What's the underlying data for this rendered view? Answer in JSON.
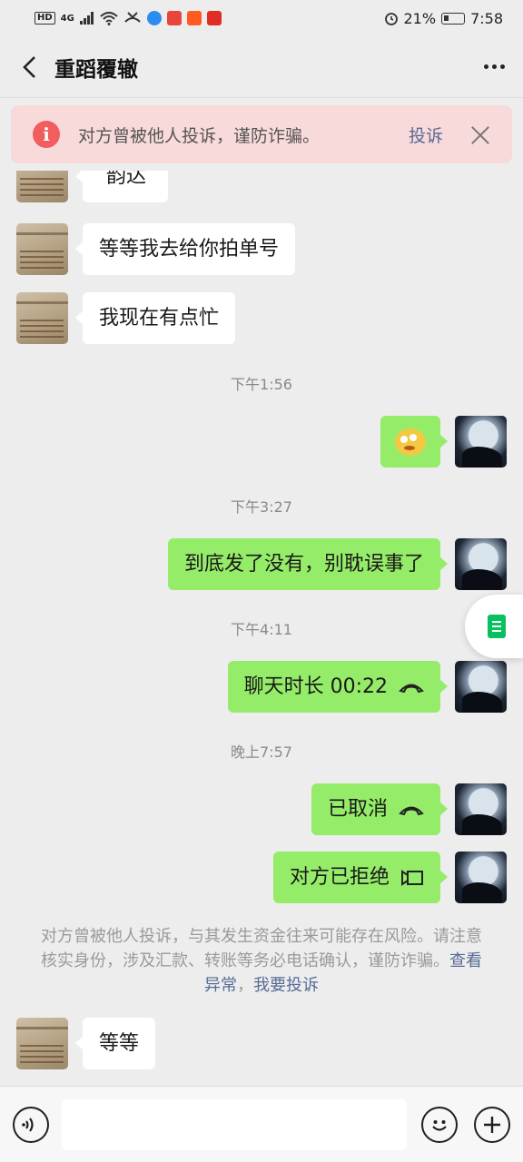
{
  "status_bar": {
    "network": "4G",
    "battery": "21%",
    "time": "7:58"
  },
  "header": {
    "title": "重蹈覆辙"
  },
  "warning": {
    "text": "对方曾被他人投诉，谨防诈骗。",
    "complain_label": "投诉"
  },
  "messages": {
    "m1": "韵达",
    "m2": "等等我去给你拍单号",
    "m3": "我现在有点忙",
    "t1": "下午1:56",
    "t2": "下午3:27",
    "m5": "到底发了没有，别耽误事了",
    "t3": "下午4:11",
    "m6": "聊天时长 00:22",
    "t4": "晚上7:57",
    "m7": "已取消",
    "m8": "对方已拒绝",
    "m9": "等等"
  },
  "notice": {
    "text": "对方曾被他人投诉，与其发生资金往来可能存在风险。请注意核实身份，涉及汇款、转账等务必电话确认，谨防诈骗。",
    "link_view": "查看异常",
    "separator": "，",
    "link_report": "我要投诉"
  },
  "colors": {
    "outgoing_bubble": "#95ec69",
    "incoming_bubble": "#ffffff",
    "link": "#576b95",
    "warning_bg": "#f9dada",
    "warning_icon": "#f25d5d"
  },
  "icons": [
    "back-icon",
    "more-icon",
    "warning-icon",
    "close-icon",
    "phone-hangup-icon",
    "video-call-icon",
    "voice-icon",
    "emoji-icon",
    "plus-icon",
    "document-icon"
  ]
}
